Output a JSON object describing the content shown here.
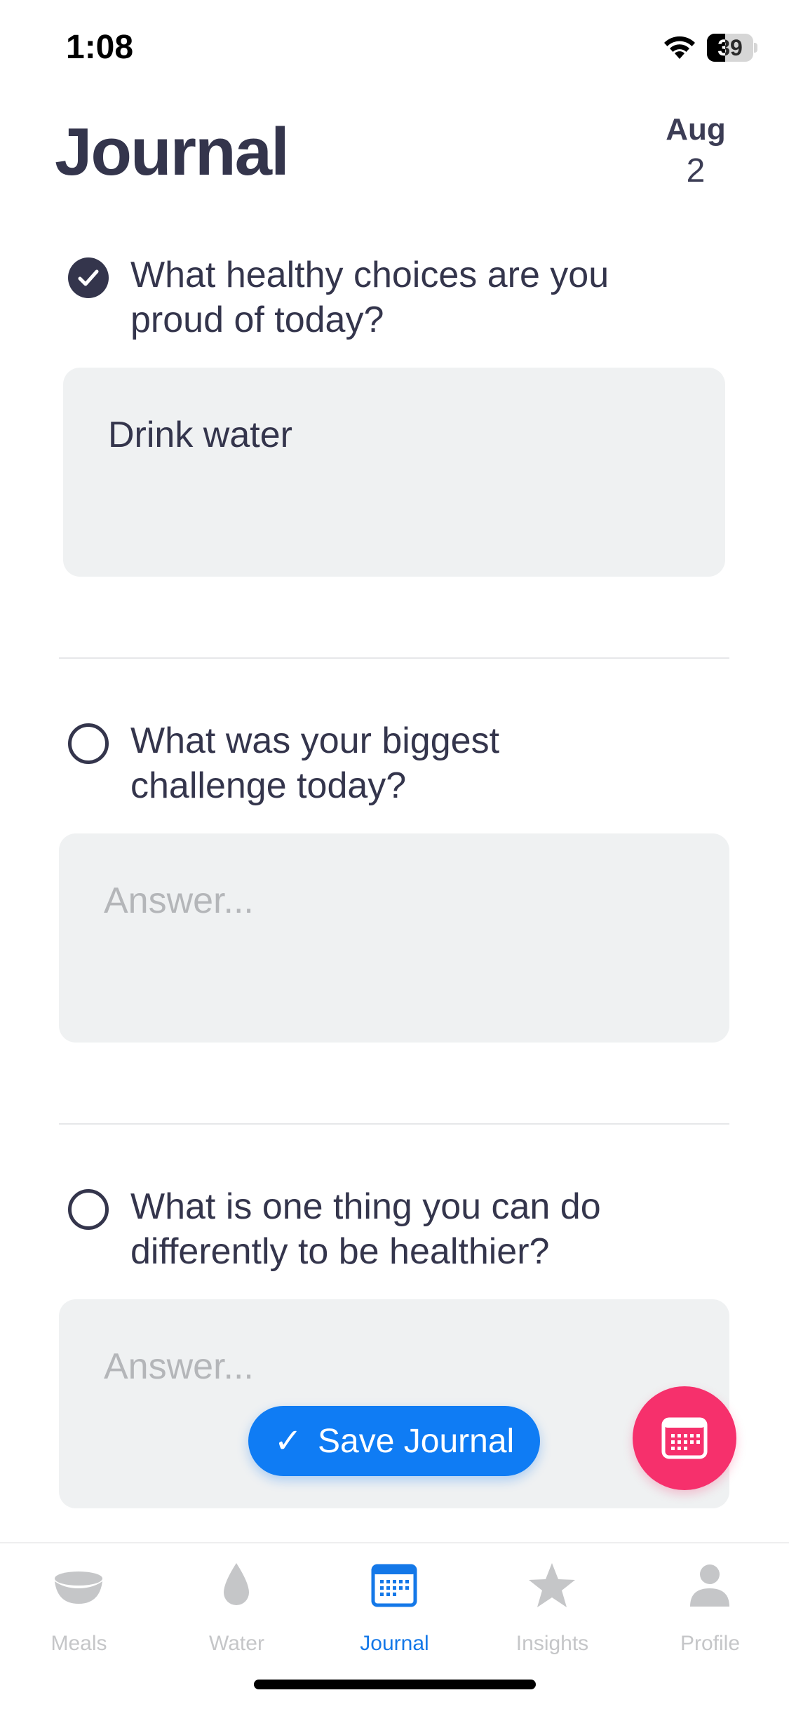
{
  "status_bar": {
    "time": "1:08",
    "battery_level": "39",
    "battery_fraction": 0.39
  },
  "header": {
    "title": "Journal",
    "date_month": "Aug",
    "date_day": "2"
  },
  "questions": [
    {
      "text": "What healthy choices are you proud of today?",
      "completed": true,
      "answer": "Drink water",
      "placeholder": "Answer..."
    },
    {
      "text": "What was your biggest challenge today?",
      "completed": false,
      "answer": "",
      "placeholder": "Answer..."
    },
    {
      "text": "What is one thing you can do differently to be healthier?",
      "completed": false,
      "answer": "",
      "placeholder": "Answer..."
    }
  ],
  "save_button": {
    "label": "Save Journal",
    "icon": "checkmark-icon"
  },
  "calendar_fab": {
    "icon": "calendar-icon"
  },
  "tabs": [
    {
      "label": "Meals",
      "icon": "bowl-icon",
      "active": false
    },
    {
      "label": "Water",
      "icon": "water-drop-icon",
      "active": false
    },
    {
      "label": "Journal",
      "icon": "calendar-icon",
      "active": true
    },
    {
      "label": "Insights",
      "icon": "star-icon",
      "active": false
    },
    {
      "label": "Profile",
      "icon": "person-icon",
      "active": false
    }
  ],
  "colors": {
    "primary_text": "#34354c",
    "accent_blue": "#0f7cf4",
    "accent_pink": "#f6306c",
    "answer_bg": "#eff1f2",
    "inactive_tab": "#c5c6c8",
    "placeholder": "#b4b6b9"
  }
}
